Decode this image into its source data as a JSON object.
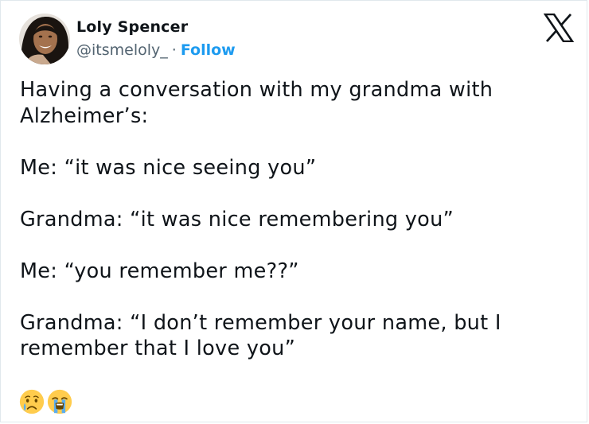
{
  "user": {
    "name": "Loly Spencer",
    "handle": "@itsmeloly_",
    "separator": "·",
    "follow_label": "Follow"
  },
  "tweet": {
    "lines": [
      "Having a conversation with my grandma with Alzheimer’s:",
      "Me: “it was nice seeing you”",
      "Grandma: “it was nice remembering you”",
      "Me: “you remember me??”",
      "Grandma: “I don’t remember your name, but I remember that I love you”"
    ],
    "emojis": [
      "crying-face",
      "loudly-crying-face"
    ]
  },
  "icons": {
    "brand": "x-logo-icon"
  },
  "colors": {
    "text": "#0f1419",
    "secondary": "#536471",
    "link": "#1d9bf0",
    "emoji": "#ffcc4d",
    "tear": "#5dadec"
  }
}
